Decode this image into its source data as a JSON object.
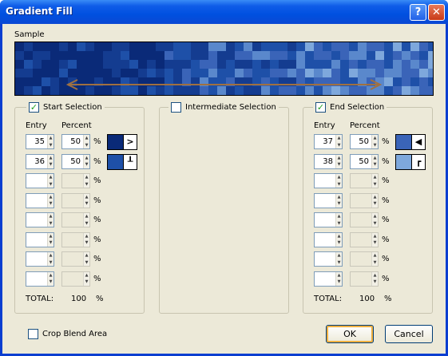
{
  "window": {
    "title": "Gradient Fill",
    "help_glyph": "?",
    "close_glyph": "✕"
  },
  "sample": {
    "label": "Sample"
  },
  "start": {
    "label": "Start Selection",
    "checked": true,
    "entry_header": "Entry",
    "percent_header": "Percent",
    "rows": [
      {
        "entry": "35",
        "percent": "50"
      },
      {
        "entry": "36",
        "percent": "50"
      },
      {
        "entry": "",
        "percent": ""
      },
      {
        "entry": "",
        "percent": ""
      },
      {
        "entry": "",
        "percent": ""
      },
      {
        "entry": "",
        "percent": ""
      },
      {
        "entry": "",
        "percent": ""
      },
      {
        "entry": "",
        "percent": ""
      }
    ],
    "swatches": [
      {
        "color": "#0a2a78",
        "glyph": ">"
      },
      {
        "color": "#1e50a8",
        "glyph": "┸"
      }
    ],
    "total_label": "TOTAL:",
    "total_value": "100",
    "total_unit": "%"
  },
  "intermediate": {
    "label": "Intermediate Selection",
    "checked": false
  },
  "end": {
    "label": "End Selection",
    "checked": true,
    "entry_header": "Entry",
    "percent_header": "Percent",
    "rows": [
      {
        "entry": "37",
        "percent": "50"
      },
      {
        "entry": "38",
        "percent": "50"
      },
      {
        "entry": "",
        "percent": ""
      },
      {
        "entry": "",
        "percent": ""
      },
      {
        "entry": "",
        "percent": ""
      },
      {
        "entry": "",
        "percent": ""
      },
      {
        "entry": "",
        "percent": ""
      },
      {
        "entry": "",
        "percent": ""
      }
    ],
    "swatches": [
      {
        "color": "#3a64b8",
        "glyph": "◀"
      },
      {
        "color": "#7ea8dc",
        "glyph": "┏"
      }
    ],
    "total_label": "TOTAL:",
    "total_value": "100",
    "total_unit": "%"
  },
  "percent_sign": "%",
  "crop": {
    "label": "Crop Blend Area",
    "checked": false
  },
  "buttons": {
    "ok": "OK",
    "cancel": "Cancel"
  },
  "colors": {
    "arrow": "#a07040",
    "sample_palette": [
      "#0a2a78",
      "#1e50a8",
      "#3a64b8",
      "#7ea8dc",
      "#143c90",
      "#5a88cc"
    ]
  }
}
